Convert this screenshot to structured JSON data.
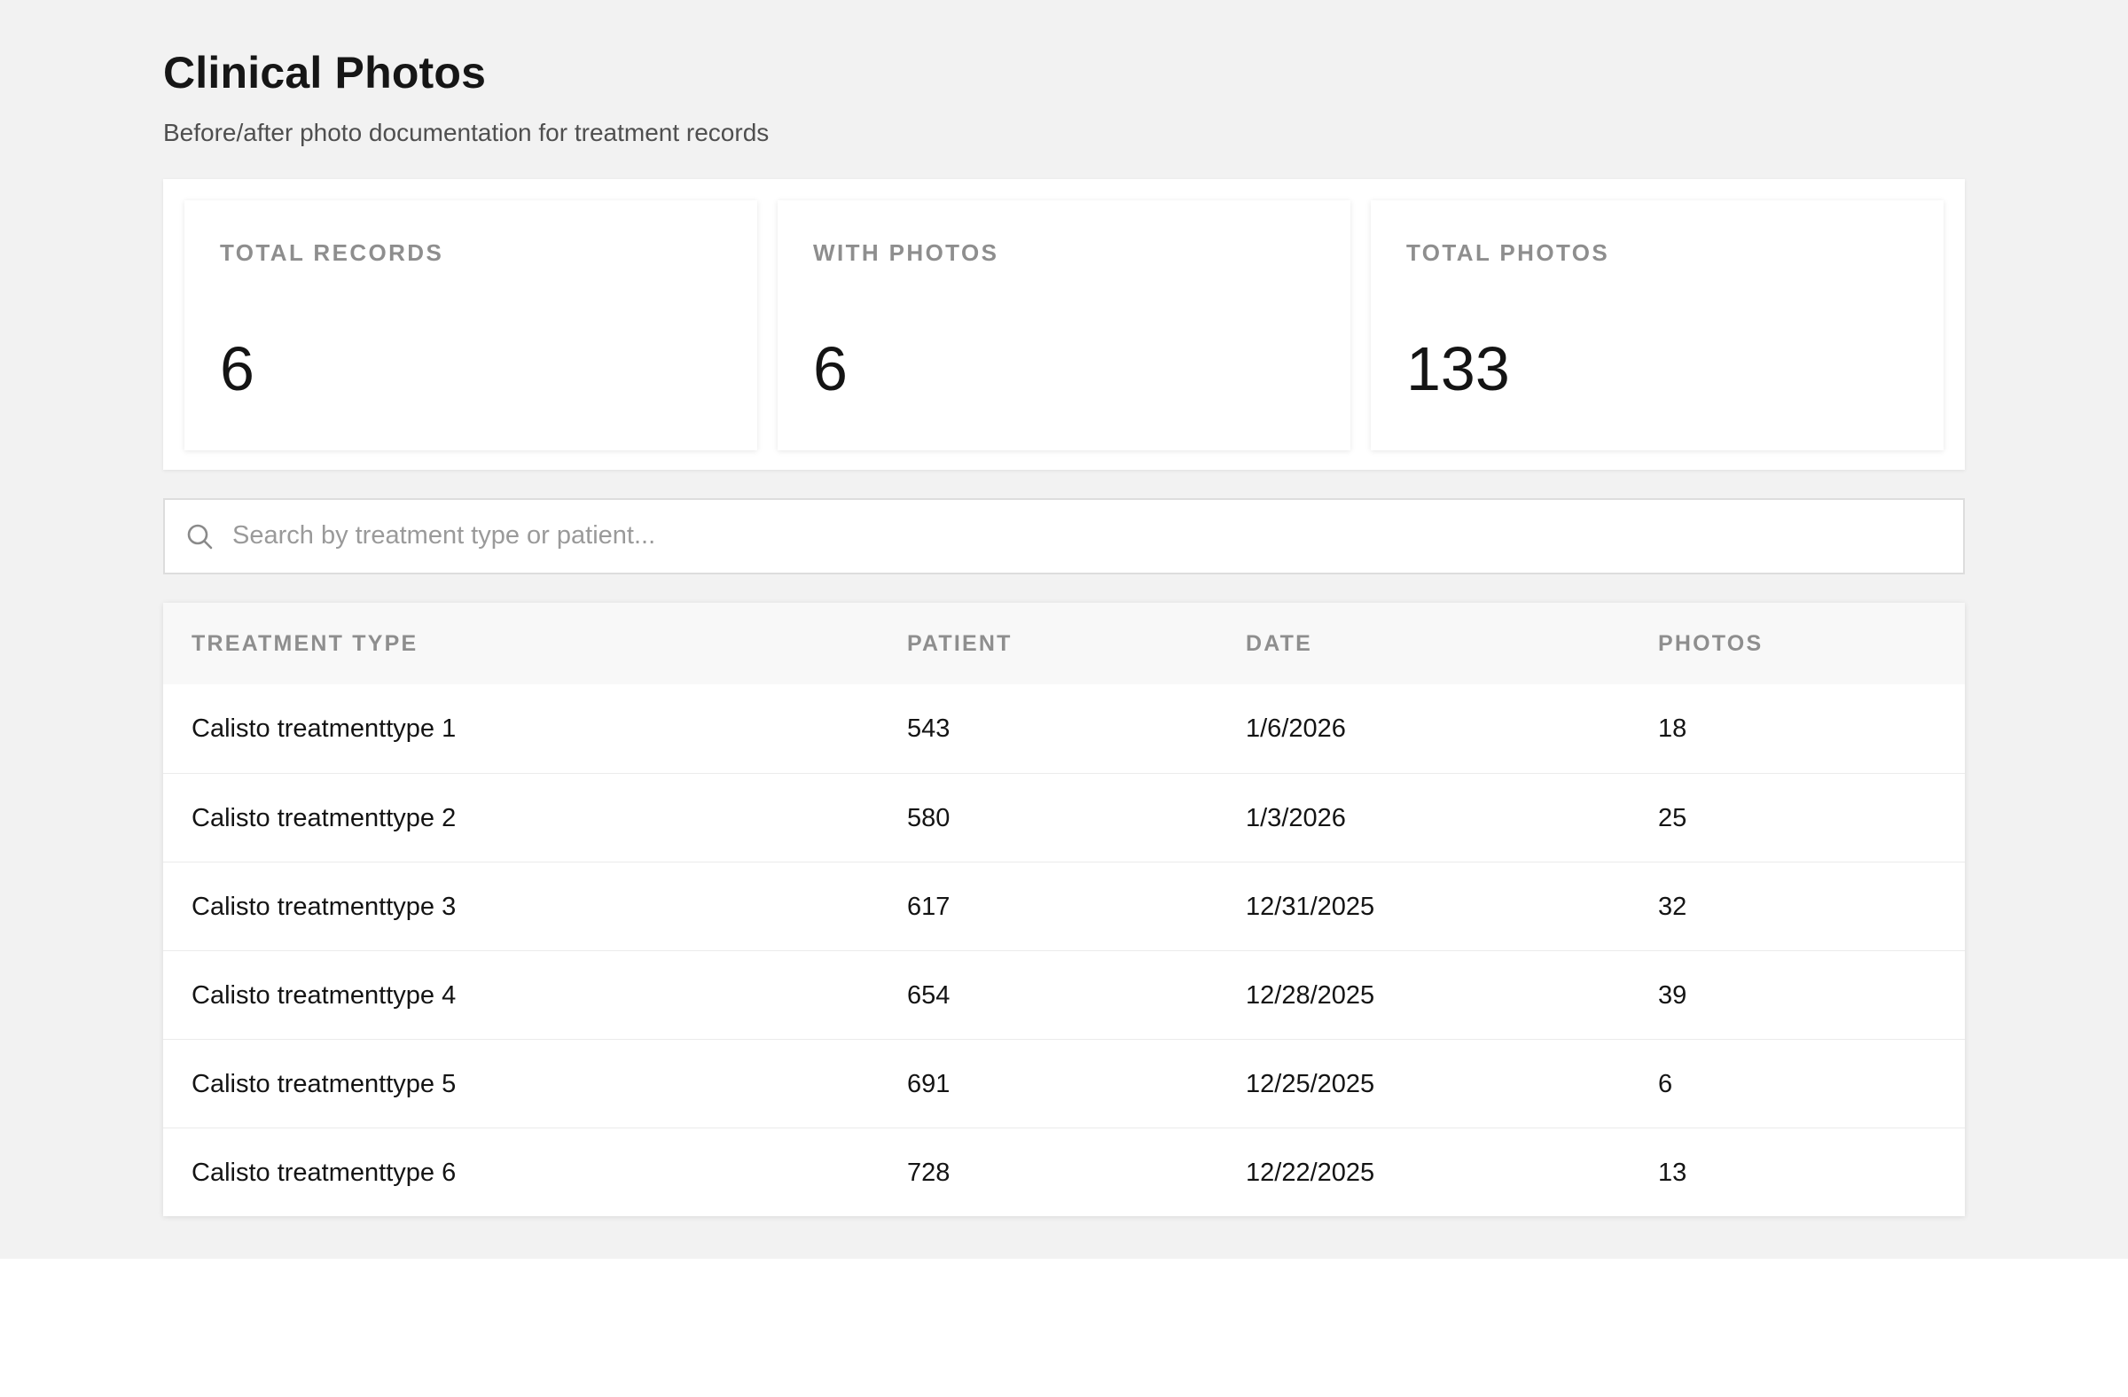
{
  "header": {
    "title": "Clinical Photos",
    "subtitle": "Before/after photo documentation for treatment records"
  },
  "stats": [
    {
      "label": "TOTAL RECORDS",
      "value": "6"
    },
    {
      "label": "WITH PHOTOS",
      "value": "6"
    },
    {
      "label": "TOTAL PHOTOS",
      "value": "133"
    }
  ],
  "search": {
    "placeholder": "Search by treatment type or patient...",
    "value": "",
    "icon": "search-icon"
  },
  "table": {
    "columns": [
      "TREATMENT TYPE",
      "PATIENT",
      "DATE",
      "PHOTOS"
    ],
    "rows": [
      {
        "treatment_type": "Calisto treatmenttype 1",
        "patient": "543",
        "date": "1/6/2026",
        "photos": "18"
      },
      {
        "treatment_type": "Calisto treatmenttype 2",
        "patient": "580",
        "date": "1/3/2026",
        "photos": "25"
      },
      {
        "treatment_type": "Calisto treatmenttype 3",
        "patient": "617",
        "date": "12/31/2025",
        "photos": "32"
      },
      {
        "treatment_type": "Calisto treatmenttype 4",
        "patient": "654",
        "date": "12/28/2025",
        "photos": "39"
      },
      {
        "treatment_type": "Calisto treatmenttype 5",
        "patient": "691",
        "date": "12/25/2025",
        "photos": "6"
      },
      {
        "treatment_type": "Calisto treatmenttype 6",
        "patient": "728",
        "date": "12/22/2025",
        "photos": "13"
      }
    ]
  },
  "colors": {
    "page_background": "#f2f2f2",
    "card_background": "#ffffff",
    "label_gray": "#8e8e8e",
    "text_dark": "#141414"
  }
}
